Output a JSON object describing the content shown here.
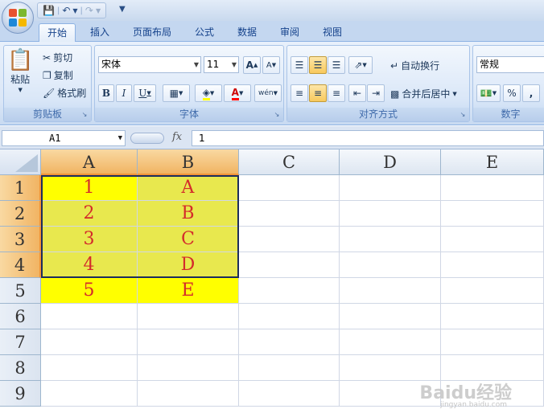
{
  "quick_access": {
    "save_icon": "save-icon",
    "undo_icon": "undo-icon",
    "redo_icon": "redo-icon",
    "customize_icon": "customize-icon"
  },
  "tabs": [
    {
      "label": "开始",
      "active": true
    },
    {
      "label": "插入"
    },
    {
      "label": "页面布局"
    },
    {
      "label": "公式"
    },
    {
      "label": "数据"
    },
    {
      "label": "审阅"
    },
    {
      "label": "视图"
    }
  ],
  "clipboard": {
    "label": "剪贴板",
    "paste": "粘贴",
    "cut": "剪切",
    "copy": "复制",
    "format_painter": "格式刷"
  },
  "font": {
    "label": "字体",
    "name": "宋体",
    "size": "11",
    "grow": "A",
    "shrink": "A",
    "bold": "B",
    "italic": "I",
    "underline": "U",
    "font_color_letter": "A",
    "phonetic": "wén"
  },
  "alignment": {
    "label": "对齐方式",
    "wrap_text": "自动换行",
    "merge_center": "合并后居中"
  },
  "number": {
    "label": "数字",
    "format": "常规",
    "percent": "%",
    "comma": ","
  },
  "formula_bar": {
    "name_box": "A1",
    "fx": "fx",
    "value": "1"
  },
  "columns": [
    "A",
    "B",
    "C",
    "D",
    "E"
  ],
  "rows": [
    "1",
    "2",
    "3",
    "4",
    "5",
    "6",
    "7",
    "8",
    "9"
  ],
  "cells": [
    [
      "1",
      "A"
    ],
    [
      "2",
      "B"
    ],
    [
      "3",
      "C"
    ],
    [
      "4",
      "D"
    ],
    [
      "5",
      "E"
    ]
  ],
  "colors": {
    "cell_text": "#d42b2b",
    "highlight": "#ffff00",
    "selection_shade": "#e8e84e",
    "header_selected": "#f1b463"
  },
  "watermark": {
    "brand": "Baidu经验",
    "url": "jingyan.baidu.com"
  }
}
